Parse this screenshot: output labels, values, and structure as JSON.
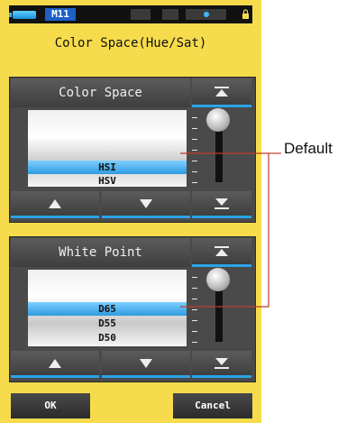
{
  "status": {
    "memory": "M11"
  },
  "screen_title": "Color Space(Hue/Sat)",
  "color_space": {
    "header": "Color Space",
    "items": [
      "",
      "HSI",
      "HSV",
      ""
    ],
    "selected": "HSI"
  },
  "white_point": {
    "header": "White Point",
    "items": [
      "",
      "D65",
      "D55",
      "D50"
    ],
    "selected": "D65"
  },
  "footer": {
    "ok": "OK",
    "cancel": "Cancel"
  },
  "callout": {
    "label": "Default"
  },
  "colors": {
    "background": "#f6dc4c",
    "accent": "#2aa4e8",
    "panel": "#4a4a4a",
    "callout_line": "#c0392b"
  }
}
